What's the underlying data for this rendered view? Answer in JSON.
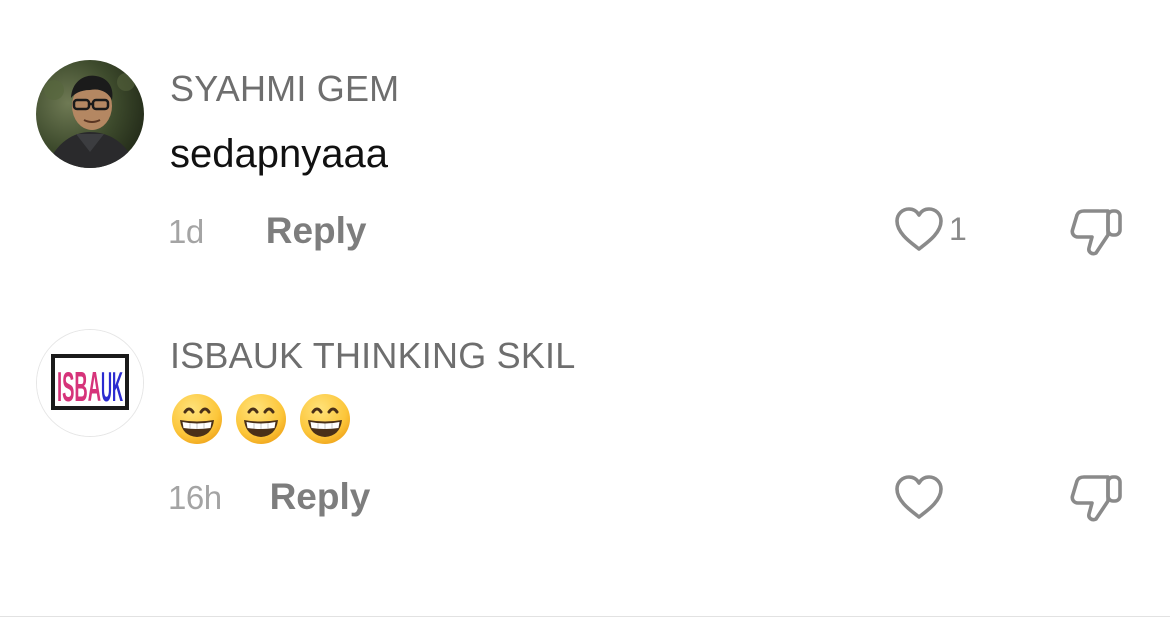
{
  "comments": [
    {
      "username": "SYAHMI GEM",
      "text": "sedapnyaaa",
      "time": "1d",
      "reply_label": "Reply",
      "like_count": "1"
    },
    {
      "username": "ISBAUK THINKING SKIL",
      "emojis": [
        "grinning-face-with-smiling-eyes",
        "grinning-face-with-smiling-eyes",
        "grinning-face-with-smiling-eyes"
      ],
      "avatar_logo_text": "ISBA UK",
      "time": "16h",
      "reply_label": "Reply",
      "like_count": ""
    }
  ],
  "colors": {
    "username": "#6e6e6e",
    "body_text": "#111111",
    "timestamp": "#a4a4a4",
    "reply": "#7d7d7d",
    "icon_stroke": "#8a8a8a",
    "logo_pink": "#d6337a",
    "logo_blue": "#2b2bd0"
  }
}
